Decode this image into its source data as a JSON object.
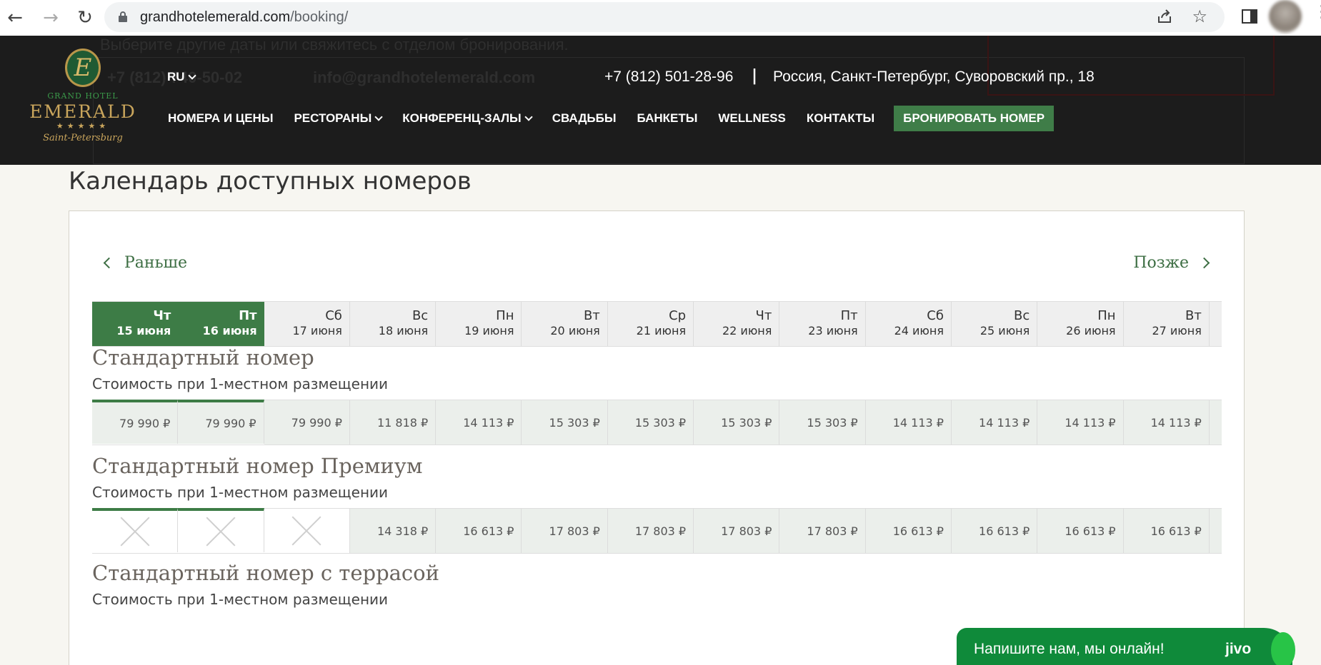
{
  "browser": {
    "url_host": "grandhotelemerald.com",
    "url_path": "/booking/"
  },
  "header": {
    "ghost_message": "Выберите другие даты или свяжитесь с отделом бронирования.",
    "ghost_phone": "+7 (812) 740-50-02",
    "ghost_email": "info@grandhotelemerald.com",
    "logo": {
      "grand_hotel": "GRAND HOTEL",
      "name": "EMERALD",
      "stars": "★★★★★",
      "city": "Saint-Petersburg",
      "monogram": "E"
    },
    "language": "RU",
    "phone": "+7 (812) 501-28-96",
    "separator": "|",
    "address": "Россия, Санкт-Петербург, Суворовский пр., 18",
    "nav": [
      {
        "label": "НОМЕРА И ЦЕНЫ",
        "dropdown": false
      },
      {
        "label": "РЕСТОРАНЫ",
        "dropdown": true
      },
      {
        "label": "КОНФЕРЕНЦ-ЗАЛЫ",
        "dropdown": true
      },
      {
        "label": "СВАДЬБЫ",
        "dropdown": false
      },
      {
        "label": "БАНКЕТЫ",
        "dropdown": false
      },
      {
        "label": "WELLNESS",
        "dropdown": false
      },
      {
        "label": "КОНТАКТЫ",
        "dropdown": false
      }
    ],
    "book_button": "БРОНИРОВАТЬ НОМЕР"
  },
  "page": {
    "title": "Календарь доступных номеров",
    "prev_label": "Раньше",
    "next_label": "Позже"
  },
  "days": [
    {
      "wd": "Чт",
      "date": "15 июня",
      "selected": true
    },
    {
      "wd": "Пт",
      "date": "16 июня",
      "selected": true
    },
    {
      "wd": "Сб",
      "date": "17 июня",
      "selected": false
    },
    {
      "wd": "Вс",
      "date": "18 июня",
      "selected": false
    },
    {
      "wd": "Пн",
      "date": "19 июня",
      "selected": false
    },
    {
      "wd": "Вт",
      "date": "20 июня",
      "selected": false
    },
    {
      "wd": "Ср",
      "date": "21 июня",
      "selected": false
    },
    {
      "wd": "Чт",
      "date": "22 июня",
      "selected": false
    },
    {
      "wd": "Пт",
      "date": "23 июня",
      "selected": false
    },
    {
      "wd": "Сб",
      "date": "24 июня",
      "selected": false
    },
    {
      "wd": "Вс",
      "date": "25 июня",
      "selected": false
    },
    {
      "wd": "Пн",
      "date": "26 июня",
      "selected": false
    },
    {
      "wd": "Вт",
      "date": "27 июня",
      "selected": false
    }
  ],
  "rooms": [
    {
      "name": "Стандартный номер",
      "subtitle": "Стоимость при 1-местном размещении",
      "prices": [
        "79 990 ₽",
        "79 990 ₽",
        "79 990 ₽",
        "11 818 ₽",
        "14 113 ₽",
        "15 303 ₽",
        "15 303 ₽",
        "15 303 ₽",
        "15 303 ₽",
        "14 113 ₽",
        "14 113 ₽",
        "14 113 ₽",
        "14 113 ₽"
      ]
    },
    {
      "name": "Стандартный номер Премиум",
      "subtitle": "Стоимость при 1-местном размещении",
      "prices": [
        null,
        null,
        null,
        "14 318 ₽",
        "16 613 ₽",
        "17 803 ₽",
        "17 803 ₽",
        "17 803 ₽",
        "17 803 ₽",
        "16 613 ₽",
        "16 613 ₽",
        "16 613 ₽",
        "16 613 ₽"
      ]
    },
    {
      "name": "Стандартный номер с террасой",
      "subtitle": "Стоимость при 1-местном размещении"
    }
  ],
  "chat": {
    "text": "Напишите нам, мы онлайн!",
    "brand": "jivo"
  }
}
